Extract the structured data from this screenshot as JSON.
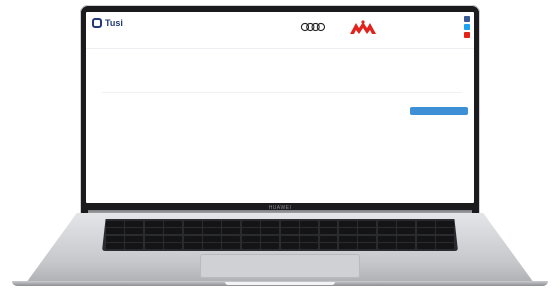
{
  "header": {
    "logo_text": "Tusi",
    "logo_subtext": "",
    "tagline": "",
    "sponsor_audi_label": "",
    "contact_title": "",
    "contact_subtitle": ""
  },
  "social": {
    "icons": [
      "facebook-icon",
      "twitter-icon",
      "youtube-icon"
    ],
    "colors": [
      "#3b5998",
      "#1da1f2",
      "#e62117"
    ]
  },
  "nav": {
    "items": [
      "",
      "",
      "",
      "",
      "",
      "",
      "",
      "",
      "",
      "",
      ""
    ]
  },
  "breadcrumb": "",
  "section": {
    "title": ""
  },
  "filters": {
    "labels": [
      "",
      "",
      "",
      ""
    ]
  },
  "search_button": {
    "label": ""
  },
  "results": {
    "cells": [
      "",
      "",
      "",
      "",
      "",
      ""
    ]
  },
  "bezel": {
    "brand": "HUAWEI"
  },
  "colors": {
    "accent": "#3d8fd6",
    "brand": "#233a78",
    "kappa": "#e0231c"
  }
}
